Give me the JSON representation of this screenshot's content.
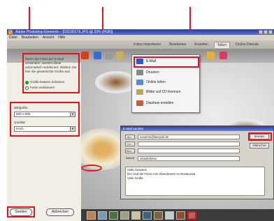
{
  "window": {
    "title": "Adobe Photoshop Elements – [DSC00176.JPG @ 33% (RGB)]"
  },
  "menubar": [
    "Datei",
    "Bearbeiten",
    "Ansicht",
    "Hilfe"
  ],
  "tabs": [
    {
      "label": "Fotos importieren",
      "active": false
    },
    {
      "label": "Bearbeiten",
      "active": false
    },
    {
      "label": "Erstellen",
      "active": false
    },
    {
      "label": "Teilen",
      "active": true
    },
    {
      "label": "Online-Dienste",
      "active": false
    }
  ],
  "left_panel": {
    "description": "Wenn Sie Fotos per E-Mail versenden, werden diese automatisch verkleinert. Wählen Sie hier die gewünschte Größe aus.",
    "option_1": "Grafik-Dateien belassen",
    "option_2": "Fotos verkleinern",
    "select_1_label": "Bildgröße",
    "select_1_value": "800 x 600",
    "select_2_label": "Qualität",
    "select_2_value": "Hoch",
    "send_button": "Senden",
    "cancel_button": "Abbrechen"
  },
  "share_menu": {
    "items": [
      "E-Mail",
      "Drucken",
      "Online teilen",
      "Bilder auf CD brennen",
      "Diashow erstellen"
    ]
  },
  "mail_dialog": {
    "title": "E-Mail senden",
    "to_label": "An...",
    "to_value": "susanne@beispiel.de",
    "cc_label": "Cc...",
    "bcc_label": "Bcc...",
    "subject_label": "Betreff",
    "subject_value": "Urlaubsfotos",
    "body_lines": [
      "Hallo Susanne,",
      "hier sind die Fotos vom Abendessen im Restaurant.",
      "Viele Grüße"
    ],
    "send_button": "Senden",
    "cancel_button": "Abbrechen"
  },
  "colors": {
    "annotation": "#e0141c",
    "title_bar": "#2a3d9c",
    "radio_on": "#1a9d1a"
  }
}
